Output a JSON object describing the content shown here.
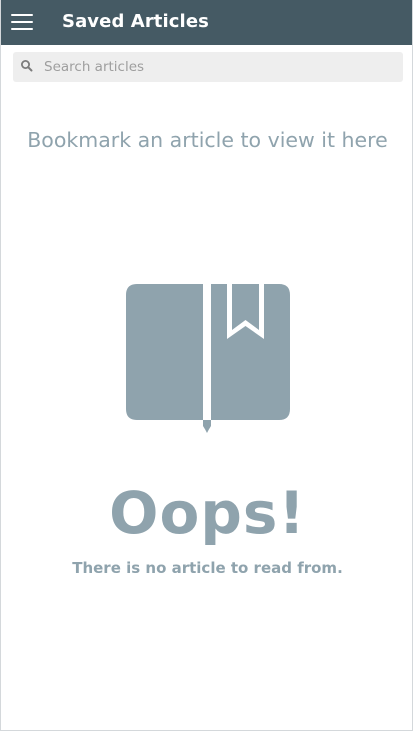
{
  "header": {
    "title": "Saved Articles",
    "menu_icon": "hamburger-menu-icon",
    "background_color": "#455a64",
    "text_color": "#ffffff"
  },
  "search": {
    "placeholder": "Search articles",
    "value": "",
    "icon": "search-icon"
  },
  "empty_state": {
    "hint": "Bookmark an article to view it here",
    "illustration_icon": "bookmarked-book-icon",
    "headline": "Oops!",
    "message": "There is no article to read from.",
    "accent_color": "#8fa3ad"
  }
}
